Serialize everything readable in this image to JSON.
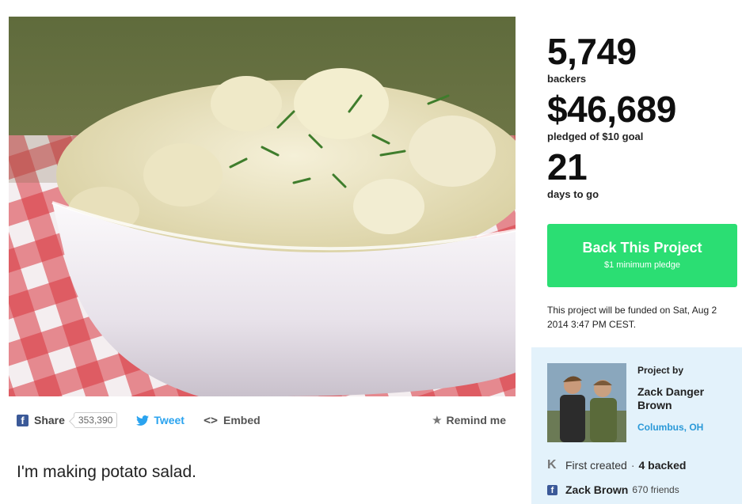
{
  "stats": {
    "backers_count": "5,749",
    "backers_label": "backers",
    "pledged_amount": "$46,689",
    "pledged_label": "pledged of $10 goal",
    "days_count": "21",
    "days_label": "days to go"
  },
  "cta": {
    "title": "Back This Project",
    "subtitle": "$1 minimum pledge"
  },
  "funding_note": "This project will be funded on Sat, Aug 2 2014 3:47 PM CEST.",
  "share": {
    "facebook_label": "Share",
    "facebook_count": "353,390",
    "tweet_label": "Tweet",
    "embed_label": "Embed",
    "remind_label": "Remind me"
  },
  "blurb": "I'm making potato salad.",
  "creator": {
    "project_by_label": "Project by",
    "name": "Zack Danger Brown",
    "location": "Columbus, OH",
    "first_created": "First created",
    "backed": "4 backed",
    "facebook_name": "Zack Brown",
    "facebook_friends": "670 friends"
  },
  "icons": {
    "facebook": "facebook-icon",
    "twitter": "twitter-bird-icon",
    "embed": "code-brackets-icon",
    "remind": "star-icon",
    "kickstarter": "kickstarter-k-icon"
  },
  "colors": {
    "cta_green": "#2bde73",
    "creator_panel_bg": "#e3f2fb",
    "link_blue": "#2a99d8",
    "twitter_blue": "#2aa3ef",
    "facebook_blue": "#3b5998"
  }
}
